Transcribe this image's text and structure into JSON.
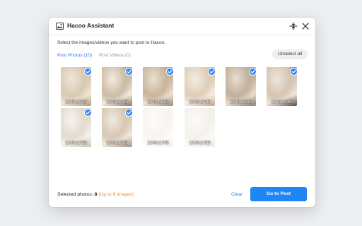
{
  "window": {
    "title": "Hacoo Assistant",
    "icons": {
      "app": "image-icon",
      "minimize": "collapse-icon",
      "close": "close-icon"
    }
  },
  "instruction": "Select the images/videos you want to post to Hacoo.",
  "tabs": [
    {
      "label": "Post Photos (10)",
      "active": true
    },
    {
      "label": "Post Videos (0)",
      "active": false
    }
  ],
  "unselect_all_label": "Unselect all",
  "photos": [
    {
      "size": "1340x1785",
      "selected": true
    },
    {
      "size": "1340x1785",
      "selected": true
    },
    {
      "size": "1340x1785",
      "selected": true
    },
    {
      "size": "1340x1785",
      "selected": true
    },
    {
      "size": "1340x1785",
      "selected": true
    },
    {
      "size": "1340x1785",
      "selected": true
    },
    {
      "size": "1340x1785",
      "selected": true
    },
    {
      "size": "1340x1785",
      "selected": true
    },
    {
      "size": "1340x1785",
      "selected": false
    },
    {
      "size": "1340x1785",
      "selected": false
    }
  ],
  "footer": {
    "selected_prefix": "Selected photos: ",
    "selected_count": "8",
    "limit_text": "(Up to 8 images)",
    "clear_label": "Clear",
    "go_label": "Go to Post"
  },
  "colors": {
    "accent": "#1f84f4",
    "limit": "#f08a2a"
  }
}
